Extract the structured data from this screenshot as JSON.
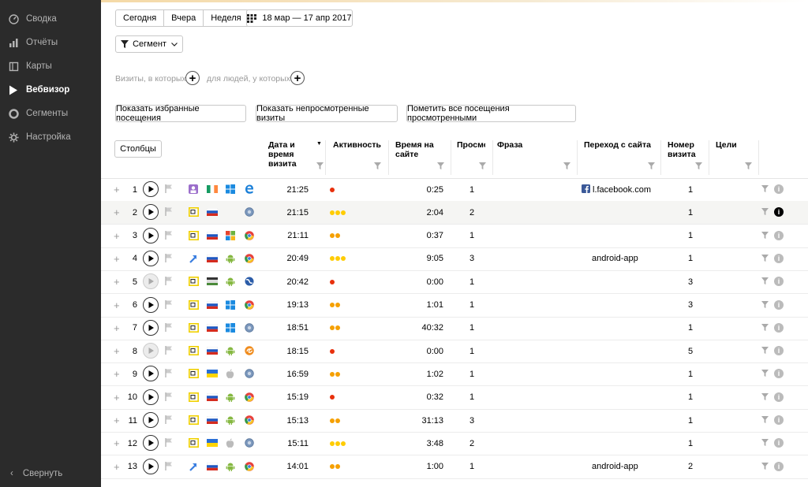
{
  "sidebar": {
    "items": [
      {
        "label": "Сводка",
        "icon": "gauge-icon"
      },
      {
        "label": "Отчёты",
        "icon": "bar-chart-icon"
      },
      {
        "label": "Карты",
        "icon": "map-icon"
      },
      {
        "label": "Вебвизор",
        "icon": "play-icon",
        "active": true
      },
      {
        "label": "Сегменты",
        "icon": "pie-icon"
      },
      {
        "label": "Настройка",
        "icon": "gear-icon"
      }
    ],
    "collapse_label": "Свернуть"
  },
  "periods": [
    "Сегодня",
    "Вчера",
    "Неделя"
  ],
  "date_range": "18 мар — 17 апр 2017",
  "segment_label": "Сегмент",
  "filters": {
    "visits_label": "Визиты, в которых",
    "people_label": "для людей, у которых"
  },
  "actions": [
    "Показать избранные посещения",
    "Показать непросмотренные визиты",
    "Пометить все посещения просмотренными"
  ],
  "columns_button": "Столбцы",
  "headers": {
    "datetime": [
      "Дата и",
      "время",
      "визита"
    ],
    "activity": "Активность",
    "duration": [
      "Время на",
      "сайте"
    ],
    "views": "Просмо",
    "phrase": "Фраза",
    "referrer": "Переход с сайта",
    "visit_no": [
      "Номер",
      "визита"
    ],
    "goals": "Цели"
  },
  "colors": {
    "dot_red": "#e8300c",
    "dot_orange": "#f5a000",
    "dot_yellow": "#ffcc00",
    "accent": "#f2a23a"
  },
  "rows": [
    {
      "n": "1",
      "time": "21:25",
      "activity": 1,
      "duration": "0:25",
      "views": "1",
      "referrer": "l.facebook.com",
      "visit": "1",
      "src": "avatar",
      "flag": "ie",
      "os": "windows",
      "browser": "edge",
      "play": true
    },
    {
      "n": "2",
      "time": "21:15",
      "activity": 3,
      "duration": "2:04",
      "views": "2",
      "referrer": "",
      "visit": "1",
      "src": "yandex",
      "flag": "ru",
      "os": "",
      "browser": "generic",
      "play": true,
      "hl": true
    },
    {
      "n": "3",
      "time": "21:11",
      "activity": 2,
      "duration": "0:37",
      "views": "1",
      "referrer": "",
      "visit": "1",
      "src": "yandex",
      "flag": "ru",
      "os": "windows-old",
      "browser": "chrome",
      "play": true
    },
    {
      "n": "4",
      "time": "20:49",
      "activity": 3,
      "duration": "9:05",
      "views": "3",
      "referrer": "android-app",
      "visit": "1",
      "src": "link",
      "flag": "ru",
      "os": "android",
      "browser": "chrome",
      "play": true
    },
    {
      "n": "5",
      "time": "20:42",
      "activity": 1,
      "duration": "0:00",
      "views": "1",
      "referrer": "",
      "visit": "3",
      "src": "yandex",
      "flag": "other",
      "os": "android",
      "browser": "globe",
      "play": false
    },
    {
      "n": "6",
      "time": "19:13",
      "activity": 2,
      "duration": "1:01",
      "views": "1",
      "referrer": "",
      "visit": "3",
      "src": "yandex",
      "flag": "ru",
      "os": "windows",
      "browser": "chrome",
      "play": true
    },
    {
      "n": "7",
      "time": "18:51",
      "activity": 2,
      "duration": "40:32",
      "views": "1",
      "referrer": "",
      "visit": "1",
      "src": "yandex",
      "flag": "ru",
      "os": "windows-blue",
      "browser": "generic",
      "play": true
    },
    {
      "n": "8",
      "time": "18:15",
      "activity": 1,
      "duration": "0:00",
      "views": "1",
      "referrer": "",
      "visit": "5",
      "src": "yandex",
      "flag": "ru",
      "os": "android",
      "browser": "uc",
      "play": false
    },
    {
      "n": "9",
      "time": "16:59",
      "activity": 2,
      "duration": "1:02",
      "views": "1",
      "referrer": "",
      "visit": "1",
      "src": "yandex",
      "flag": "ua",
      "os": "apple",
      "browser": "generic",
      "play": true
    },
    {
      "n": "10",
      "time": "15:19",
      "activity": 1,
      "duration": "0:32",
      "views": "1",
      "referrer": "",
      "visit": "1",
      "src": "yandex",
      "flag": "ru",
      "os": "android",
      "browser": "chrome",
      "play": true
    },
    {
      "n": "11",
      "time": "15:13",
      "activity": 2,
      "duration": "31:13",
      "views": "3",
      "referrer": "",
      "visit": "1",
      "src": "yandex",
      "flag": "ru",
      "os": "android",
      "browser": "chrome",
      "play": true
    },
    {
      "n": "12",
      "time": "15:11",
      "activity": 3,
      "duration": "3:48",
      "views": "2",
      "referrer": "",
      "visit": "1",
      "src": "yandex",
      "flag": "ua",
      "os": "apple",
      "browser": "generic",
      "play": true
    },
    {
      "n": "13",
      "time": "14:01",
      "activity": 2,
      "duration": "1:00",
      "views": "1",
      "referrer": "android-app",
      "visit": "2",
      "src": "link",
      "flag": "ru",
      "os": "android",
      "browser": "chrome",
      "play": true
    }
  ]
}
